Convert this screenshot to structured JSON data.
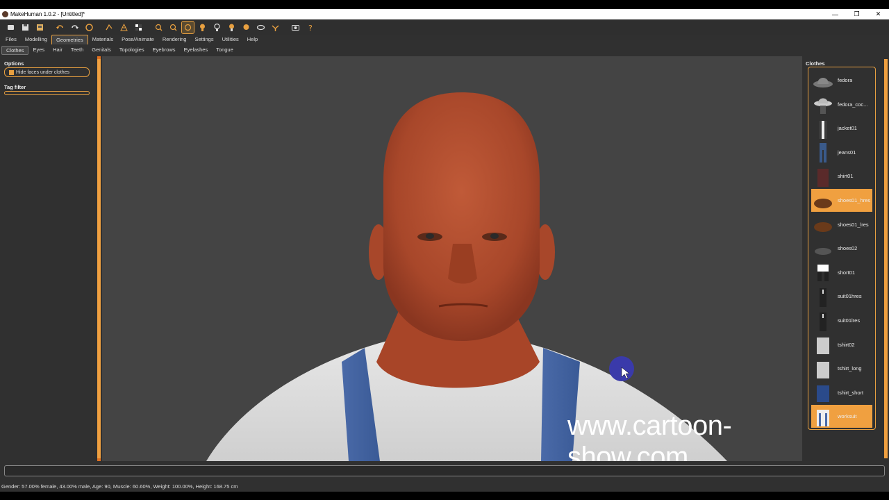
{
  "window": {
    "title": "MakeHuman 1.0.2 - [Untitled]*",
    "controls": [
      "—",
      "❐",
      "✕"
    ]
  },
  "toolbar": {
    "icons": [
      "new-icon",
      "save-icon",
      "export-icon",
      "undo-icon",
      "redo-icon",
      "reset-icon",
      "smooth-icon",
      "wireframe-icon",
      "background-icon",
      "pose-zoom-in-icon",
      "zoom-out-icon",
      "front-view-icon",
      "back-view-icon",
      "left-view-icon",
      "right-view-icon",
      "top-view-icon",
      "bottom-view-icon",
      "skeleton-icon",
      "screenshot-icon",
      "help-icon"
    ],
    "active_index": 11
  },
  "main_tabs": [
    {
      "label": "Files"
    },
    {
      "label": "Modelling"
    },
    {
      "label": "Geometries"
    },
    {
      "label": "Materials"
    },
    {
      "label": "Pose/Animate"
    },
    {
      "label": "Rendering"
    },
    {
      "label": "Settings"
    },
    {
      "label": "Utilities"
    },
    {
      "label": "Help"
    }
  ],
  "main_tab_active": "Geometries",
  "sub_tabs": [
    {
      "label": "Clothes"
    },
    {
      "label": "Eyes"
    },
    {
      "label": "Hair"
    },
    {
      "label": "Teeth"
    },
    {
      "label": "Genitals"
    },
    {
      "label": "Topologies"
    },
    {
      "label": "Eyebrows"
    },
    {
      "label": "Eyelashes"
    },
    {
      "label": "Tongue"
    }
  ],
  "sub_tab_active": "Clothes",
  "left_panel": {
    "options_title": "Options",
    "hide_faces_label": "Hide faces under clothes",
    "hide_faces_checked": true,
    "tag_filter_title": "Tag filter"
  },
  "right_panel": {
    "title": "Clothes",
    "items": [
      {
        "label": "fedora",
        "thumb": "hat",
        "selected": false
      },
      {
        "label": "fedora_coc...",
        "thumb": "hat-dark",
        "selected": false
      },
      {
        "label": "jacket01",
        "thumb": "jacket",
        "selected": false
      },
      {
        "label": "jeans01",
        "thumb": "jeans",
        "selected": false
      },
      {
        "label": "shirt01",
        "thumb": "shirt",
        "selected": false
      },
      {
        "label": "shoes01_hres",
        "thumb": "shoe",
        "selected": true
      },
      {
        "label": "shoes01_lres",
        "thumb": "shoe",
        "selected": false
      },
      {
        "label": "shoes02",
        "thumb": "shoe-dark",
        "selected": false
      },
      {
        "label": "short01",
        "thumb": "shorts",
        "selected": false
      },
      {
        "label": "suit01hres",
        "thumb": "suit",
        "selected": false
      },
      {
        "label": "suit01lres",
        "thumb": "suit",
        "selected": false
      },
      {
        "label": "tshirt02",
        "thumb": "tshirt",
        "selected": false
      },
      {
        "label": "tshirt_long",
        "thumb": "tshirt",
        "selected": false
      },
      {
        "label": "tshirt_short",
        "thumb": "tshirt-blue",
        "selected": false
      },
      {
        "label": "worksuit",
        "thumb": "worksuit",
        "selected": true
      }
    ]
  },
  "watermark": "www.cartoon-show.com",
  "status": "Gender: 57.00% female, 43.00% male, Age: 90, Muscle: 60.60%, Weight: 100.00%, Height: 168.75 cm",
  "colors": {
    "accent": "#e8a040",
    "skin": "#b8502f",
    "background": "#444444"
  }
}
